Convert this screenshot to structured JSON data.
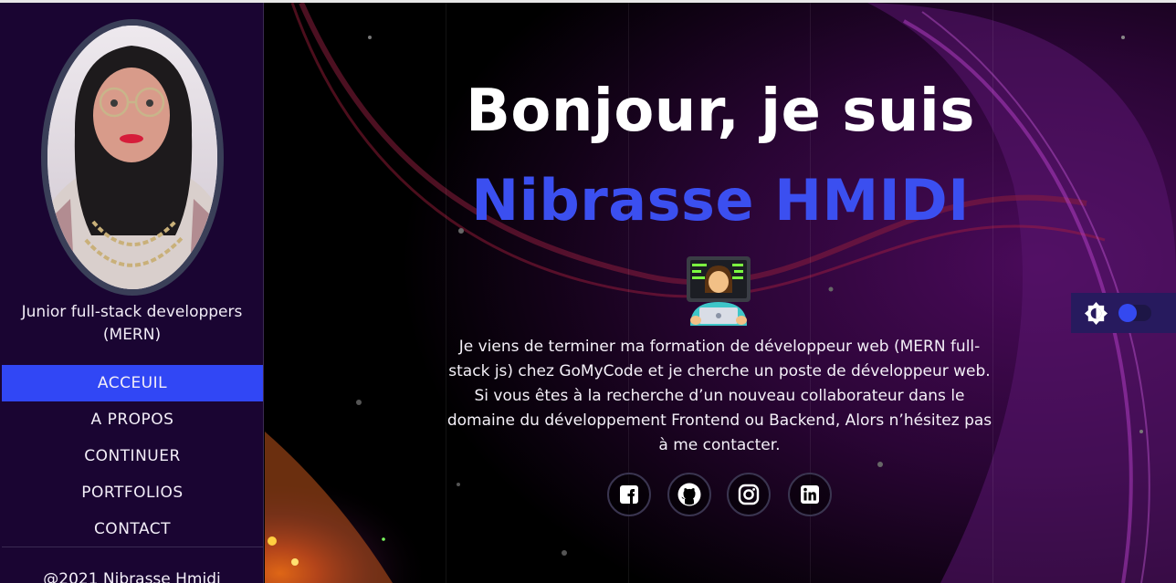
{
  "sidebar": {
    "role": "Junior full-stack developpers (MERN)",
    "nav": [
      {
        "label": "ACCEUIL",
        "active": true
      },
      {
        "label": "A PROPOS",
        "active": false
      },
      {
        "label": "CONTINUER",
        "active": false
      },
      {
        "label": "PORTFOLIOS",
        "active": false
      },
      {
        "label": "CONTACT",
        "active": false
      }
    ],
    "copyright": "@2021 Nibrasse Hmidi"
  },
  "hero": {
    "greeting": "Bonjour, je suis",
    "name": "Nibrasse HMIDI",
    "intro": "Je viens de terminer ma formation de développeur web (MERN full-stack js) chez GoMyCode et je cherche un poste de développeur web. Si vous êtes à la recherche d’un nouveau collaborateur dans le domaine du développement Frontend ou Backend, Alors n’hésitez pas à me contacter."
  },
  "socials": [
    {
      "icon": "facebook-icon"
    },
    {
      "icon": "github-icon"
    },
    {
      "icon": "instagram-icon"
    },
    {
      "icon": "linkedin-icon"
    }
  ],
  "theme_toggle": {
    "icon": "brightness-icon",
    "state": "off"
  },
  "colors": {
    "accent": "#3147f5",
    "name": "#3b4ff0",
    "sidebar_bg": "#1a0532"
  }
}
